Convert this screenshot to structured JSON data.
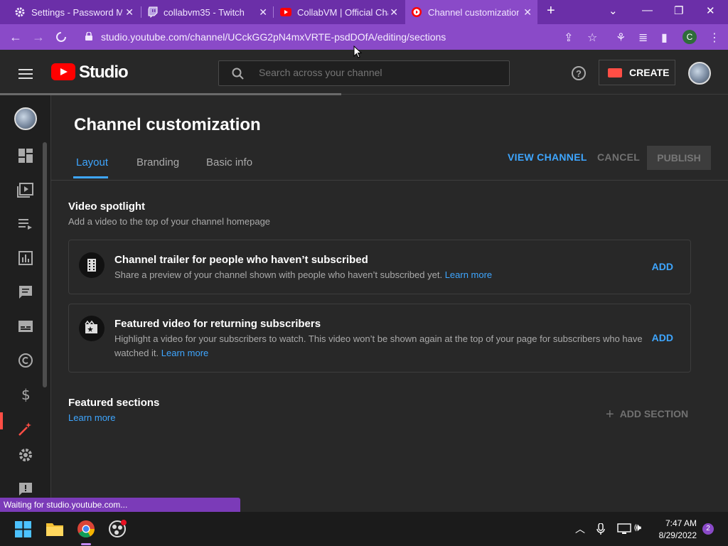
{
  "browser": {
    "tabs": [
      {
        "title": "Settings - Password Ma",
        "icon": "gear-icon"
      },
      {
        "title": "collabvm35 - Twitch",
        "icon": "twitch-icon"
      },
      {
        "title": "CollabVM | Official Cha",
        "icon": "youtube-icon"
      },
      {
        "title": "Channel customization",
        "icon": "youtube-studio-icon"
      }
    ],
    "new_tab": "+",
    "url": "studio.youtube.com/channel/UCckGG2pN4mxVRTE-psdDOfA/editing/sections",
    "profile_initial": "C",
    "status": "Waiting for studio.youtube.com..."
  },
  "header": {
    "logo_text": "Studio",
    "search_placeholder": "Search across your channel",
    "create_label": "CREATE",
    "help": "?"
  },
  "page": {
    "title": "Channel customization",
    "tabs": [
      {
        "label": "Layout",
        "active": true
      },
      {
        "label": "Branding",
        "active": false
      },
      {
        "label": "Basic info",
        "active": false
      }
    ],
    "actions": {
      "view_channel": "VIEW CHANNEL",
      "cancel": "CANCEL",
      "publish": "PUBLISH"
    }
  },
  "video_spotlight": {
    "title": "Video spotlight",
    "desc": "Add a video to the top of your channel homepage",
    "cards": [
      {
        "title": "Channel trailer for people who haven’t subscribed",
        "desc": "Share a preview of your channel shown with people who haven’t subscribed yet.",
        "link": "Learn more",
        "action": "ADD"
      },
      {
        "title": "Featured video for returning subscribers",
        "desc": "Highlight a video for your subscribers to watch. This video won’t be shown again at the top of your page for subscribers who have watched it.",
        "link": "Learn more",
        "action": "ADD"
      }
    ]
  },
  "featured_sections": {
    "title": "Featured sections",
    "link": "Learn more",
    "add_section": "ADD SECTION"
  },
  "taskbar": {
    "time": "7:47 AM",
    "date": "8/29/2022",
    "notifications": "2"
  },
  "colors": {
    "accent_blue": "#3ea6ff",
    "browser_purple": "#8a4ac8",
    "youtube_red": "#ff0000"
  }
}
